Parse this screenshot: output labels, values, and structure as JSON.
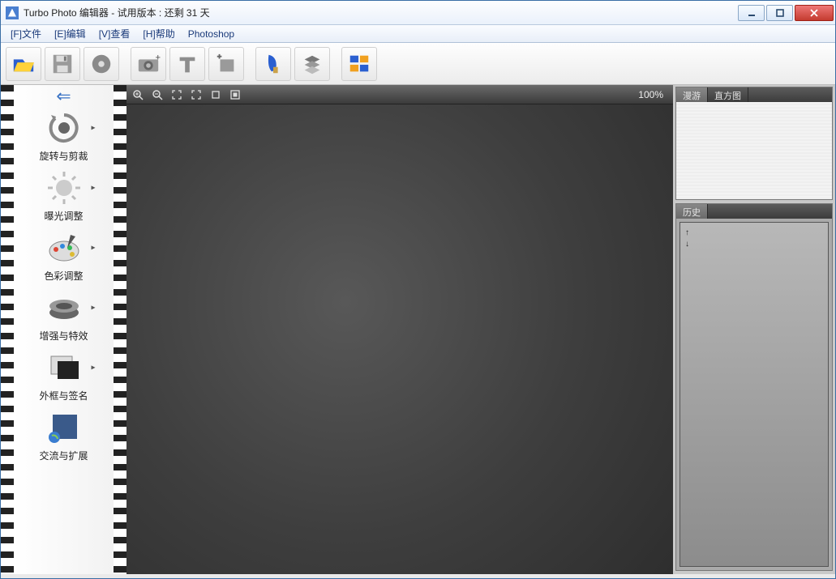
{
  "window": {
    "title": "Turbo Photo 编辑器  - 试用版本 : 还剩 31 天"
  },
  "menu": {
    "file": "[F]文件",
    "edit": "[E]编辑",
    "view": "[V]查看",
    "help": "[H]帮助",
    "photoshop": "Photoshop"
  },
  "zoom": {
    "value": "100%"
  },
  "sidebar": {
    "items": [
      {
        "label": "旋转与剪裁"
      },
      {
        "label": "曝光调整"
      },
      {
        "label": "色彩调整"
      },
      {
        "label": "增强与特效"
      },
      {
        "label": "外框与签名"
      },
      {
        "label": "交流与扩展"
      }
    ]
  },
  "right": {
    "nav_tab": "漫游",
    "hist_tab": "直方图",
    "history_label": "历史"
  }
}
